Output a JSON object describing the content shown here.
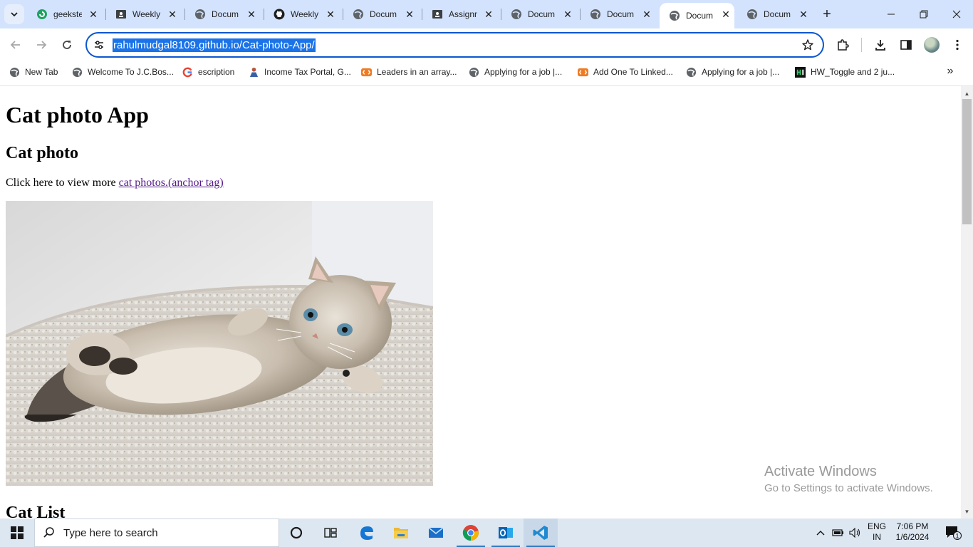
{
  "browser": {
    "tabs": [
      {
        "title": "geekste",
        "icon": "google-docs-icon",
        "active": false
      },
      {
        "title": "Weekly",
        "icon": "classroom-icon",
        "active": false
      },
      {
        "title": "Docum",
        "icon": "globe-icon",
        "active": false
      },
      {
        "title": "Weekly",
        "icon": "github-icon",
        "active": false
      },
      {
        "title": "Docum",
        "icon": "globe-icon",
        "active": false
      },
      {
        "title": "Assignm",
        "icon": "classroom-icon",
        "active": false
      },
      {
        "title": "Docum",
        "icon": "globe-icon",
        "active": false
      },
      {
        "title": "Docum",
        "icon": "globe-icon",
        "active": false
      },
      {
        "title": "Docum",
        "icon": "globe-icon",
        "active": true
      },
      {
        "title": "Docum",
        "icon": "globe-icon",
        "active": false
      }
    ],
    "url": "rahulmudgal8109.github.io/Cat-photo-App/",
    "bookmarks": [
      {
        "label": "New Tab",
        "icon": "globe-icon"
      },
      {
        "label": "Welcome To J.C.Bos...",
        "icon": "globe-icon"
      },
      {
        "label": "escription",
        "icon": "google-icon"
      },
      {
        "label": "Income Tax Portal, G...",
        "icon": "income-tax-icon"
      },
      {
        "label": "Leaders in an array...",
        "icon": "coding-ninjas-icon"
      },
      {
        "label": "Applying for a job |...",
        "icon": "globe-icon"
      },
      {
        "label": "Add One To Linked...",
        "icon": "coding-ninjas-icon"
      },
      {
        "label": "Applying for a job |...",
        "icon": "globe-icon"
      },
      {
        "label": "HW_Toggle and 2 ju...",
        "icon": "hackerrank-icon"
      }
    ],
    "accent_color": "#0b57d0",
    "tabstrip_color": "#d3e3fd"
  },
  "page": {
    "title": "Cat photo App",
    "section_photo_heading": "Cat photo",
    "intro_text": "Click here to view more ",
    "link_text": "cat photos.(anchor tag)",
    "image_alt": "kitten lying on white fluffy rug",
    "section_list_heading": "Cat List",
    "link_color": "#551a8b"
  },
  "watermark": {
    "line1": "Activate Windows",
    "line2": "Go to Settings to activate Windows."
  },
  "taskbar": {
    "search_placeholder": "Type here to search",
    "apps": [
      "cortana-icon",
      "task-view-icon",
      "edge-icon",
      "file-explorer-icon",
      "mail-icon",
      "chrome-icon",
      "outlook-icon",
      "vscode-icon"
    ],
    "language_line1": "ENG",
    "language_line2": "IN",
    "time": "7:06 PM",
    "date": "1/6/2024",
    "notification_count": "1"
  }
}
